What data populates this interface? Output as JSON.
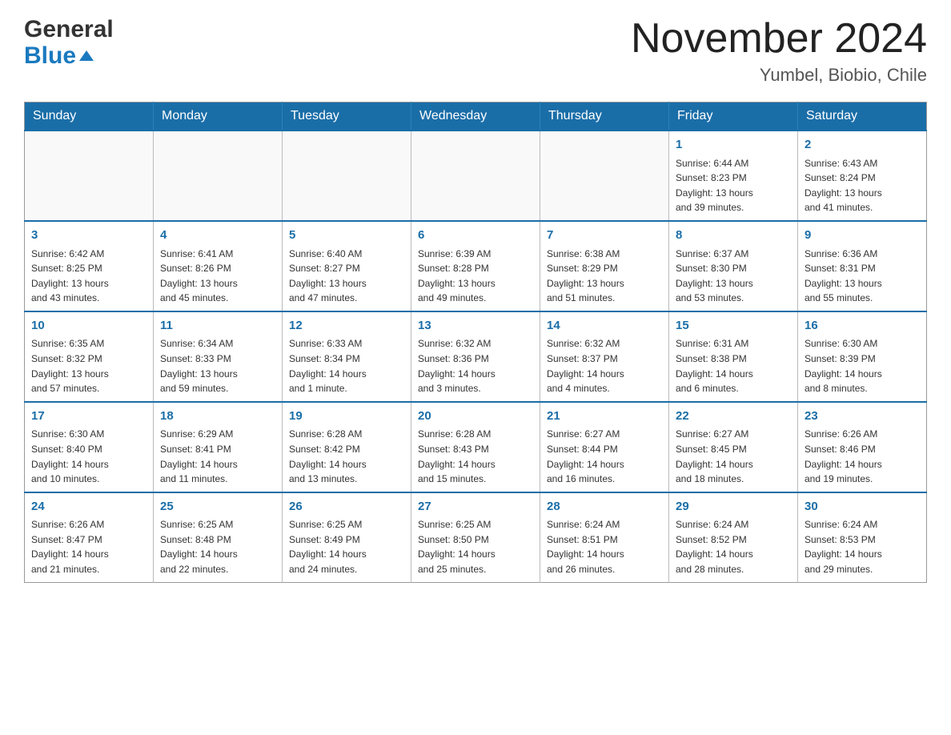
{
  "header": {
    "logo": {
      "general": "General",
      "blue": "Blue",
      "triangle": "▲"
    },
    "title": "November 2024",
    "location": "Yumbel, Biobio, Chile"
  },
  "calendar": {
    "days": [
      "Sunday",
      "Monday",
      "Tuesday",
      "Wednesday",
      "Thursday",
      "Friday",
      "Saturday"
    ],
    "weeks": [
      [
        {
          "day": "",
          "info": ""
        },
        {
          "day": "",
          "info": ""
        },
        {
          "day": "",
          "info": ""
        },
        {
          "day": "",
          "info": ""
        },
        {
          "day": "",
          "info": ""
        },
        {
          "day": "1",
          "info": "Sunrise: 6:44 AM\nSunset: 8:23 PM\nDaylight: 13 hours\nand 39 minutes."
        },
        {
          "day": "2",
          "info": "Sunrise: 6:43 AM\nSunset: 8:24 PM\nDaylight: 13 hours\nand 41 minutes."
        }
      ],
      [
        {
          "day": "3",
          "info": "Sunrise: 6:42 AM\nSunset: 8:25 PM\nDaylight: 13 hours\nand 43 minutes."
        },
        {
          "day": "4",
          "info": "Sunrise: 6:41 AM\nSunset: 8:26 PM\nDaylight: 13 hours\nand 45 minutes."
        },
        {
          "day": "5",
          "info": "Sunrise: 6:40 AM\nSunset: 8:27 PM\nDaylight: 13 hours\nand 47 minutes."
        },
        {
          "day": "6",
          "info": "Sunrise: 6:39 AM\nSunset: 8:28 PM\nDaylight: 13 hours\nand 49 minutes."
        },
        {
          "day": "7",
          "info": "Sunrise: 6:38 AM\nSunset: 8:29 PM\nDaylight: 13 hours\nand 51 minutes."
        },
        {
          "day": "8",
          "info": "Sunrise: 6:37 AM\nSunset: 8:30 PM\nDaylight: 13 hours\nand 53 minutes."
        },
        {
          "day": "9",
          "info": "Sunrise: 6:36 AM\nSunset: 8:31 PM\nDaylight: 13 hours\nand 55 minutes."
        }
      ],
      [
        {
          "day": "10",
          "info": "Sunrise: 6:35 AM\nSunset: 8:32 PM\nDaylight: 13 hours\nand 57 minutes."
        },
        {
          "day": "11",
          "info": "Sunrise: 6:34 AM\nSunset: 8:33 PM\nDaylight: 13 hours\nand 59 minutes."
        },
        {
          "day": "12",
          "info": "Sunrise: 6:33 AM\nSunset: 8:34 PM\nDaylight: 14 hours\nand 1 minute."
        },
        {
          "day": "13",
          "info": "Sunrise: 6:32 AM\nSunset: 8:36 PM\nDaylight: 14 hours\nand 3 minutes."
        },
        {
          "day": "14",
          "info": "Sunrise: 6:32 AM\nSunset: 8:37 PM\nDaylight: 14 hours\nand 4 minutes."
        },
        {
          "day": "15",
          "info": "Sunrise: 6:31 AM\nSunset: 8:38 PM\nDaylight: 14 hours\nand 6 minutes."
        },
        {
          "day": "16",
          "info": "Sunrise: 6:30 AM\nSunset: 8:39 PM\nDaylight: 14 hours\nand 8 minutes."
        }
      ],
      [
        {
          "day": "17",
          "info": "Sunrise: 6:30 AM\nSunset: 8:40 PM\nDaylight: 14 hours\nand 10 minutes."
        },
        {
          "day": "18",
          "info": "Sunrise: 6:29 AM\nSunset: 8:41 PM\nDaylight: 14 hours\nand 11 minutes."
        },
        {
          "day": "19",
          "info": "Sunrise: 6:28 AM\nSunset: 8:42 PM\nDaylight: 14 hours\nand 13 minutes."
        },
        {
          "day": "20",
          "info": "Sunrise: 6:28 AM\nSunset: 8:43 PM\nDaylight: 14 hours\nand 15 minutes."
        },
        {
          "day": "21",
          "info": "Sunrise: 6:27 AM\nSunset: 8:44 PM\nDaylight: 14 hours\nand 16 minutes."
        },
        {
          "day": "22",
          "info": "Sunrise: 6:27 AM\nSunset: 8:45 PM\nDaylight: 14 hours\nand 18 minutes."
        },
        {
          "day": "23",
          "info": "Sunrise: 6:26 AM\nSunset: 8:46 PM\nDaylight: 14 hours\nand 19 minutes."
        }
      ],
      [
        {
          "day": "24",
          "info": "Sunrise: 6:26 AM\nSunset: 8:47 PM\nDaylight: 14 hours\nand 21 minutes."
        },
        {
          "day": "25",
          "info": "Sunrise: 6:25 AM\nSunset: 8:48 PM\nDaylight: 14 hours\nand 22 minutes."
        },
        {
          "day": "26",
          "info": "Sunrise: 6:25 AM\nSunset: 8:49 PM\nDaylight: 14 hours\nand 24 minutes."
        },
        {
          "day": "27",
          "info": "Sunrise: 6:25 AM\nSunset: 8:50 PM\nDaylight: 14 hours\nand 25 minutes."
        },
        {
          "day": "28",
          "info": "Sunrise: 6:24 AM\nSunset: 8:51 PM\nDaylight: 14 hours\nand 26 minutes."
        },
        {
          "day": "29",
          "info": "Sunrise: 6:24 AM\nSunset: 8:52 PM\nDaylight: 14 hours\nand 28 minutes."
        },
        {
          "day": "30",
          "info": "Sunrise: 6:24 AM\nSunset: 8:53 PM\nDaylight: 14 hours\nand 29 minutes."
        }
      ]
    ]
  }
}
